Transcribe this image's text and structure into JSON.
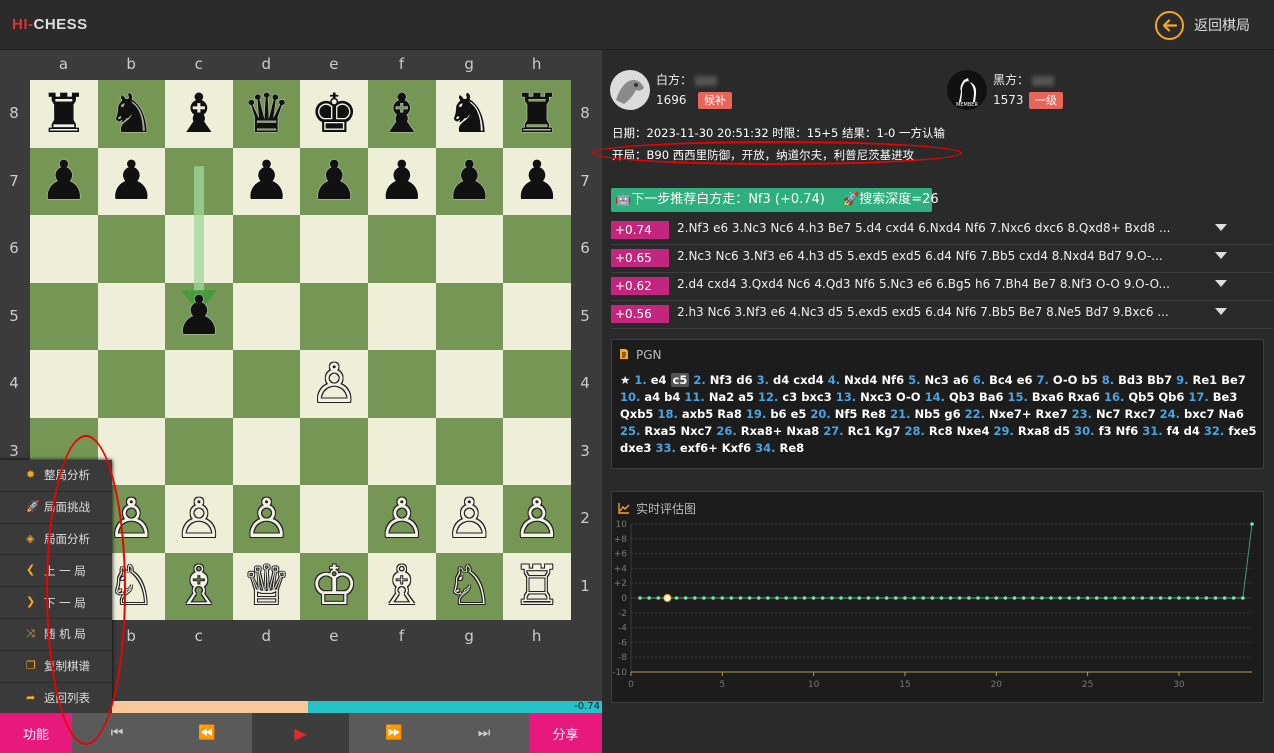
{
  "app": {
    "logo_hi": "HI-",
    "logo_rest": "CHESS",
    "back_label": "返回棋局"
  },
  "board": {
    "files": [
      "a",
      "b",
      "c",
      "d",
      "e",
      "f",
      "g",
      "h"
    ],
    "ranks": [
      "8",
      "7",
      "6",
      "5",
      "4",
      "3",
      "2",
      "1"
    ],
    "light_color": "#efefd9",
    "dark_color": "#769656",
    "pieces": [
      {
        "sq": "a8",
        "g": "♜",
        "c": "b",
        "name": "black-rook"
      },
      {
        "sq": "b8",
        "g": "♞",
        "c": "b",
        "name": "black-knight"
      },
      {
        "sq": "c8",
        "g": "♝",
        "c": "b",
        "name": "black-bishop"
      },
      {
        "sq": "d8",
        "g": "♛",
        "c": "b",
        "name": "black-queen"
      },
      {
        "sq": "e8",
        "g": "♚",
        "c": "b",
        "name": "black-king"
      },
      {
        "sq": "f8",
        "g": "♝",
        "c": "b",
        "name": "black-bishop"
      },
      {
        "sq": "g8",
        "g": "♞",
        "c": "b",
        "name": "black-knight"
      },
      {
        "sq": "h8",
        "g": "♜",
        "c": "b",
        "name": "black-rook"
      },
      {
        "sq": "a7",
        "g": "♟",
        "c": "b",
        "name": "black-pawn"
      },
      {
        "sq": "b7",
        "g": "♟",
        "c": "b",
        "name": "black-pawn"
      },
      {
        "sq": "d7",
        "g": "♟",
        "c": "b",
        "name": "black-pawn"
      },
      {
        "sq": "e7",
        "g": "♟",
        "c": "b",
        "name": "black-pawn"
      },
      {
        "sq": "f7",
        "g": "♟",
        "c": "b",
        "name": "black-pawn"
      },
      {
        "sq": "g7",
        "g": "♟",
        "c": "b",
        "name": "black-pawn"
      },
      {
        "sq": "h7",
        "g": "♟",
        "c": "b",
        "name": "black-pawn"
      },
      {
        "sq": "c5",
        "g": "♟",
        "c": "b",
        "name": "black-pawn"
      },
      {
        "sq": "e4",
        "g": "♙",
        "c": "w",
        "name": "white-pawn"
      },
      {
        "sq": "a2",
        "g": "♙",
        "c": "w",
        "name": "white-pawn"
      },
      {
        "sq": "b2",
        "g": "♙",
        "c": "w",
        "name": "white-pawn"
      },
      {
        "sq": "c2",
        "g": "♙",
        "c": "w",
        "name": "white-pawn"
      },
      {
        "sq": "d2",
        "g": "♙",
        "c": "w",
        "name": "white-pawn"
      },
      {
        "sq": "f2",
        "g": "♙",
        "c": "w",
        "name": "white-pawn"
      },
      {
        "sq": "g2",
        "g": "♙",
        "c": "w",
        "name": "white-pawn"
      },
      {
        "sq": "h2",
        "g": "♙",
        "c": "w",
        "name": "white-pawn"
      },
      {
        "sq": "a1",
        "g": "♖",
        "c": "w",
        "name": "white-rook"
      },
      {
        "sq": "b1",
        "g": "♘",
        "c": "w",
        "name": "white-knight"
      },
      {
        "sq": "c1",
        "g": "♗",
        "c": "w",
        "name": "white-bishop"
      },
      {
        "sq": "d1",
        "g": "♕",
        "c": "w",
        "name": "white-queen"
      },
      {
        "sq": "e1",
        "g": "♔",
        "c": "w",
        "name": "white-king"
      },
      {
        "sq": "f1",
        "g": "♗",
        "c": "w",
        "name": "white-bishop"
      },
      {
        "sq": "g1",
        "g": "♘",
        "c": "w",
        "name": "white-knight"
      },
      {
        "sq": "h1",
        "g": "♖",
        "c": "w",
        "name": "white-rook"
      }
    ],
    "last_move": {
      "from": "c7",
      "to": "c5"
    }
  },
  "function_menu": [
    {
      "label": "整局分析",
      "icon": "gear-icon"
    },
    {
      "label": "局面挑战",
      "icon": "rocket-icon"
    },
    {
      "label": "局面分析",
      "icon": "eye-slash-icon"
    },
    {
      "label": "上 一 局",
      "icon": "chevron-left-icon"
    },
    {
      "label": "下 一 局",
      "icon": "chevron-right-icon"
    },
    {
      "label": "随 机 局",
      "icon": "shuffle-icon"
    },
    {
      "label": "复制棋谱",
      "icon": "copy-icon"
    },
    {
      "label": "返回列表",
      "icon": "share-icon"
    }
  ],
  "eval_bar": {
    "value": "-0.74",
    "white_fraction": 0.4
  },
  "controls": {
    "func_label": "功能",
    "share_label": "分享"
  },
  "white_player": {
    "label": "白方：",
    "rating": "1696",
    "title": "候补"
  },
  "black_player": {
    "label": "黑方：",
    "rating": "1573",
    "title": "一级"
  },
  "game_info": "日期：2023-11-30 20:51:32 时限：15+5 结果：1-0 一方认输",
  "opening": "开局：B90 西西里防御，开放，纳道尔夫，利普尼茨基进攻",
  "recommend": {
    "text": "下一步推荐白方走：Nf3 (+0.74)",
    "depth": "搜索深度=26",
    "accent": "#2eaf7d"
  },
  "lines": [
    {
      "score": "+0.74",
      "moves": "2.Nf3  e6  3.Nc3  Nc6  4.h3  Be7  5.d4  cxd4  6.Nxd4  Nf6  7.Nxc6  dxc6  8.Qxd8+  Bxd8 ..."
    },
    {
      "score": "+0.65",
      "moves": "2.Nc3  Nc6  3.Nf3  e6  4.h3  d5  5.exd5  exd5  6.d4  Nf6  7.Bb5  cxd4  8.Nxd4  Bd7  9.O-..."
    },
    {
      "score": "+0.62",
      "moves": "2.d4  cxd4  3.Qxd4  Nc6  4.Qd3  Nf6  5.Nc3  e6  6.Bg5  h6  7.Bh4  Be7  8.Nf3  O-O  9.O-O..."
    },
    {
      "score": "+0.56",
      "moves": "2.h3  Nc6  3.Nf3  e6  4.Nc3  d5  5.exd5  exd5  6.d4  Nf6  7.Bb5  Be7  8.Ne5  Bd7  9.Bxc6 ..."
    }
  ],
  "pgn": {
    "title": "PGN",
    "star": "★",
    "moves": [
      [
        "1.",
        "e4",
        "c5"
      ],
      [
        "2.",
        "Nf3",
        "d6"
      ],
      [
        "3.",
        "d4",
        "cxd4"
      ],
      [
        "4.",
        "Nxd4",
        "Nf6"
      ],
      [
        "5.",
        "Nc3",
        "a6"
      ],
      [
        "6.",
        "Bc4",
        "e6"
      ],
      [
        "7.",
        "O-O",
        "b5"
      ],
      [
        "8.",
        "Bd3",
        "Bb7"
      ],
      [
        "9.",
        "Re1",
        "Be7"
      ],
      [
        "10.",
        "a4",
        "b4"
      ],
      [
        "11.",
        "Na2",
        "a5"
      ],
      [
        "12.",
        "c3",
        "bxc3"
      ],
      [
        "13.",
        "Nxc3",
        "O-O"
      ],
      [
        "14.",
        "Qb3",
        "Ba6"
      ],
      [
        "15.",
        "Bxa6",
        "Rxa6"
      ],
      [
        "16.",
        "Qb5",
        "Qb6"
      ],
      [
        "17.",
        "Be3",
        "Qxb5"
      ],
      [
        "18.",
        "axb5",
        "Ra8"
      ],
      [
        "19.",
        "b6",
        "e5"
      ],
      [
        "20.",
        "Nf5",
        "Re8"
      ],
      [
        "21.",
        "Nb5",
        "g6"
      ],
      [
        "22.",
        "Nxe7+",
        "Rxe7"
      ],
      [
        "23.",
        "Nc7",
        "Rxc7"
      ],
      [
        "24.",
        "bxc7",
        "Na6"
      ],
      [
        "25.",
        "Rxa5",
        "Nxc7"
      ],
      [
        "26.",
        "Rxa8+",
        "Nxa8"
      ],
      [
        "27.",
        "Rc1",
        "Kg7"
      ],
      [
        "28.",
        "Rc8",
        "Nxe4"
      ],
      [
        "29.",
        "Rxa8",
        "d5"
      ],
      [
        "30.",
        "f3",
        "Nf6"
      ],
      [
        "31.",
        "f4",
        "d4"
      ],
      [
        "32.",
        "fxe5",
        "dxe3"
      ],
      [
        "33.",
        "exf6+",
        "Kxf6"
      ],
      [
        "34.",
        "Re8",
        ""
      ]
    ]
  },
  "chart_data": {
    "type": "line",
    "title": "实时评估图",
    "ylim": [
      -10,
      10
    ],
    "yticks": [
      "10",
      "+8",
      "+6",
      "+4",
      "+2",
      "0",
      "-2",
      "-4",
      "-6",
      "-8",
      "-10"
    ],
    "xlim": [
      0,
      34
    ],
    "xticks": [
      "0",
      "5",
      "10",
      "15",
      "20",
      "25",
      "30"
    ],
    "grid": true,
    "series": [
      {
        "values": [
          0,
          0,
          0,
          0,
          0,
          0,
          0,
          0,
          0,
          0,
          0,
          0,
          0,
          0,
          0,
          0,
          0,
          0,
          0,
          0,
          0,
          0,
          0,
          0,
          0,
          0,
          0,
          0,
          0,
          0,
          0,
          0,
          0,
          0,
          0,
          0,
          0,
          0,
          0,
          0,
          0,
          0,
          0,
          0,
          0,
          0,
          0,
          0,
          0,
          0,
          0,
          0,
          0,
          0,
          0,
          0,
          0,
          0,
          0,
          0,
          0,
          0,
          0,
          0,
          0,
          0,
          0,
          10
        ]
      }
    ],
    "highlight_index": 3,
    "color": "#6ee7a6"
  }
}
